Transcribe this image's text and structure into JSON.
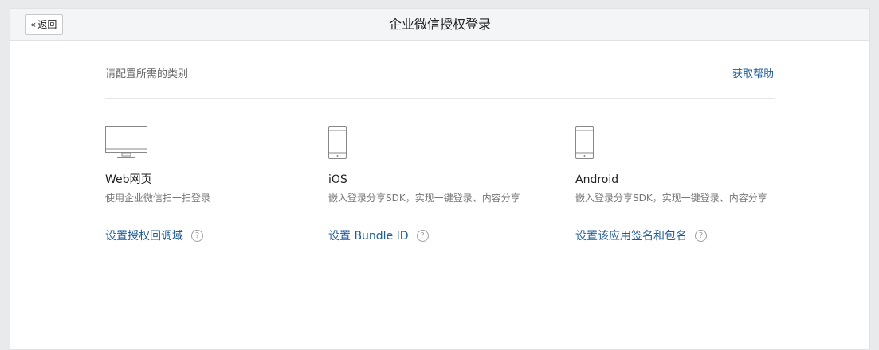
{
  "header": {
    "back_label": "返回",
    "title": "企业微信授权登录"
  },
  "main": {
    "subhead": "请配置所需的类别",
    "help_label": "获取帮助",
    "columns": [
      {
        "icon": "monitor-icon",
        "name": "Web网页",
        "desc": "使用企业微信扫一扫登录",
        "action": "设置授权回调域"
      },
      {
        "icon": "phone-icon",
        "name": "iOS",
        "desc": "嵌入登录分享SDK，实现一键登录、内容分享",
        "action": "设置 Bundle ID"
      },
      {
        "icon": "phone-icon",
        "name": "Android",
        "desc": "嵌入登录分享SDK，实现一键登录、内容分享",
        "action": "设置该应用签名和包名"
      }
    ]
  },
  "colors": {
    "link": "#1f5c98",
    "background": "#e9eaec",
    "panel": "#ffffff"
  }
}
